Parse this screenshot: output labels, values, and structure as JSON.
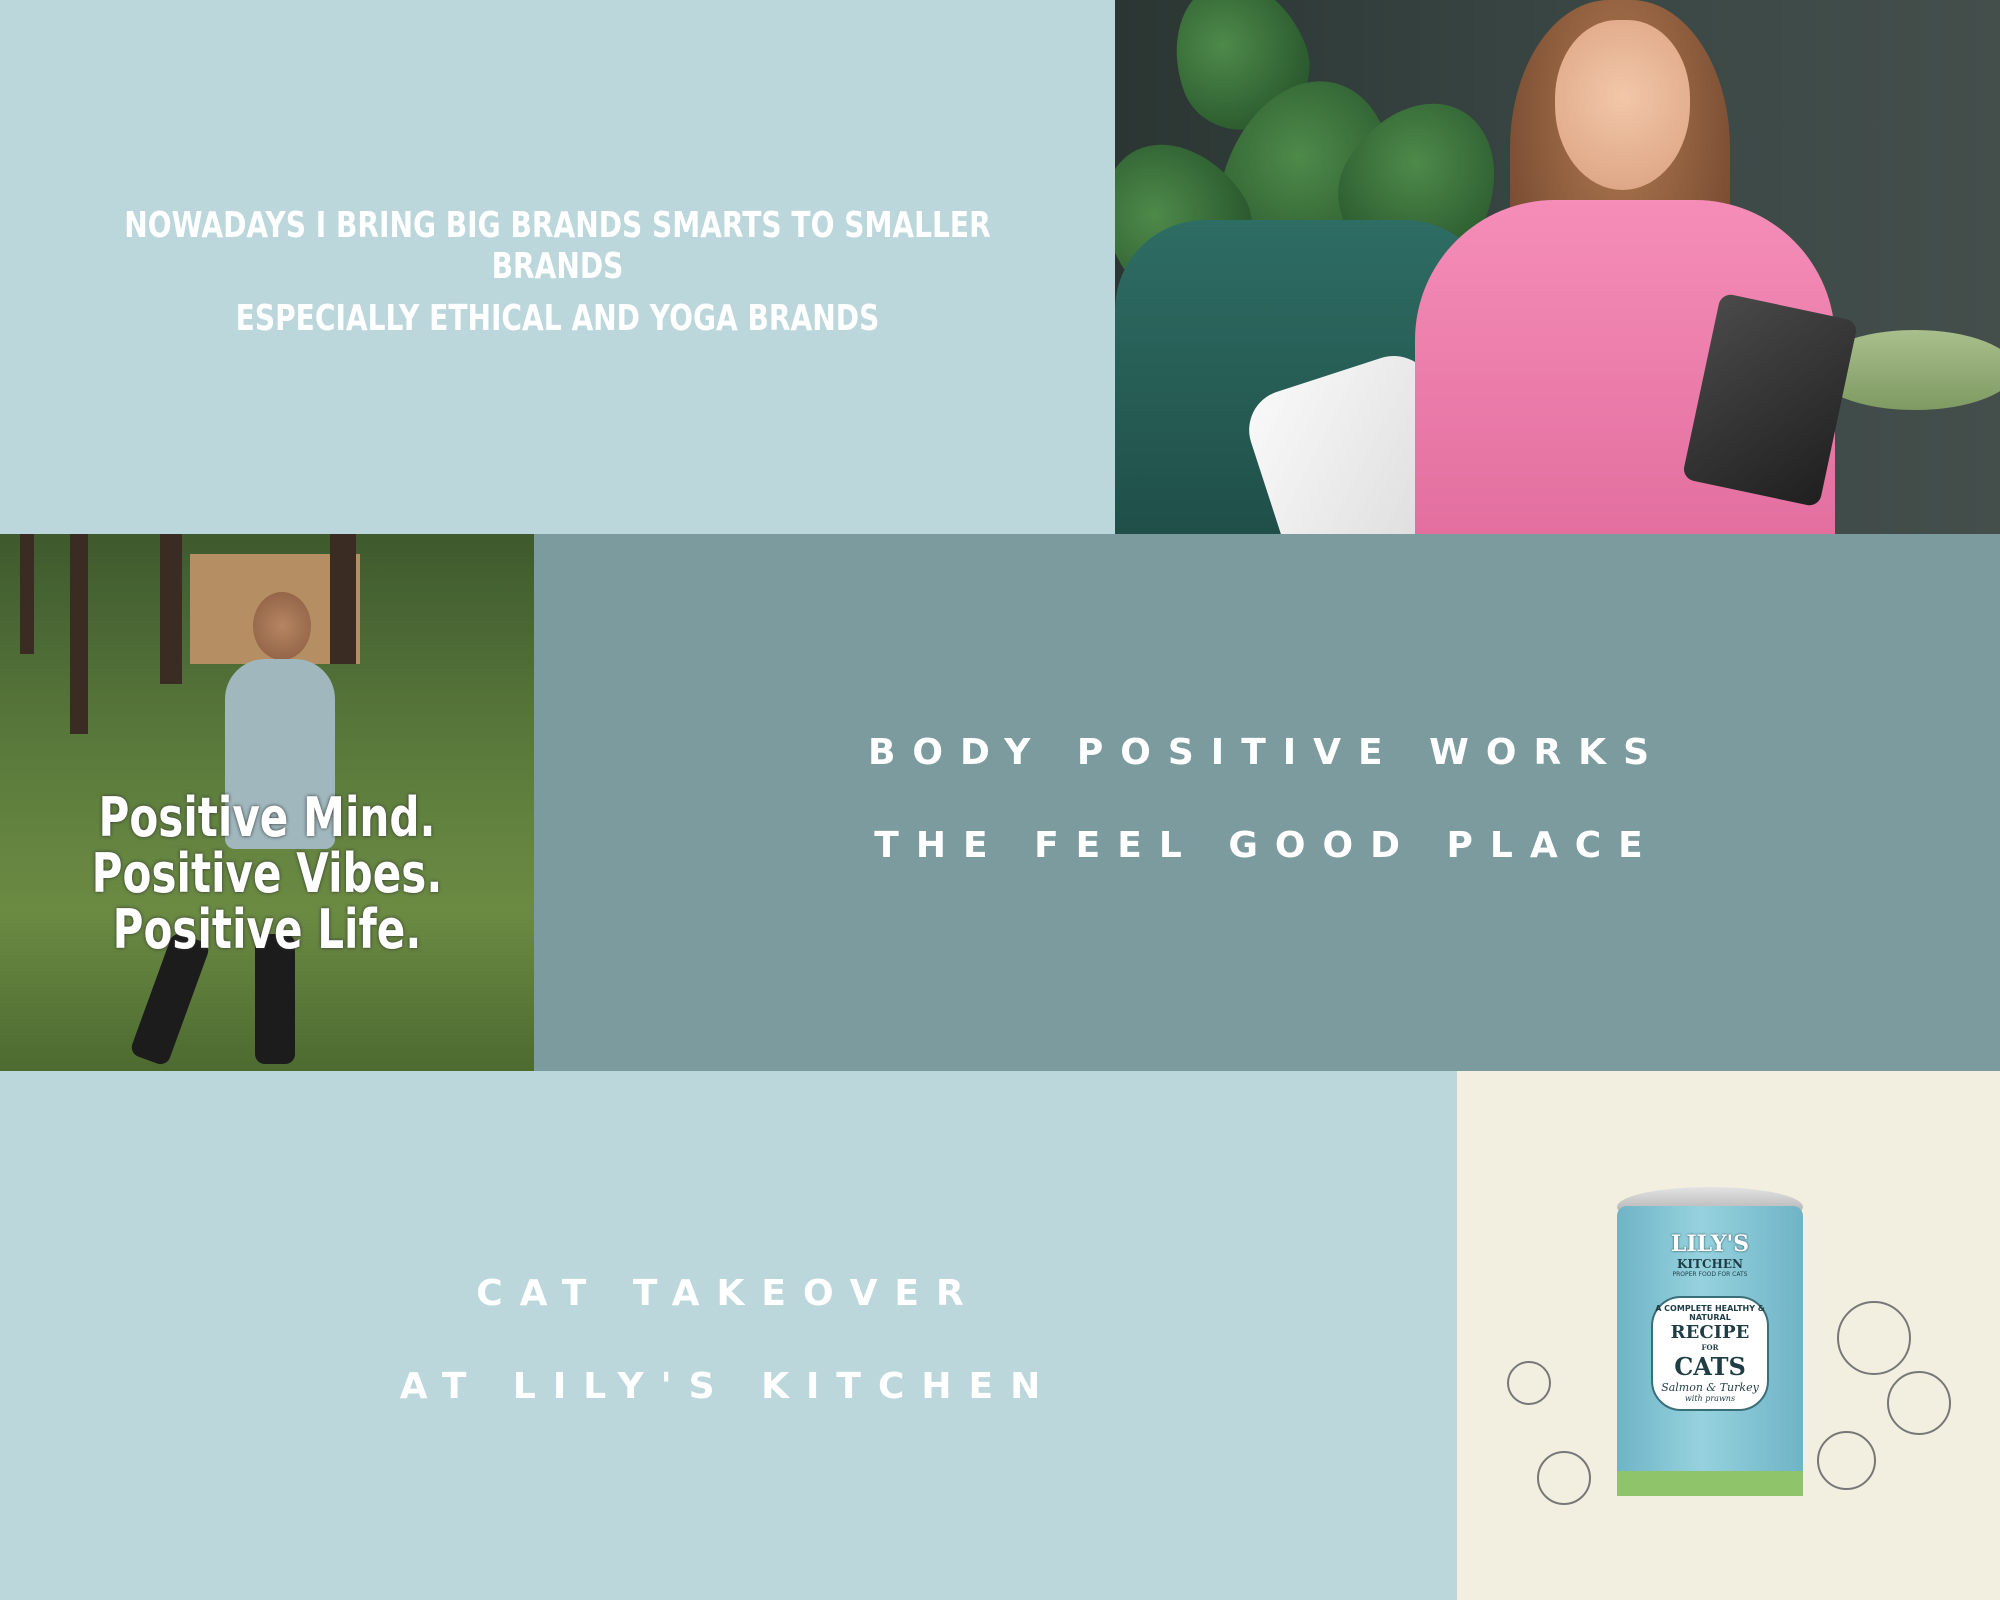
{
  "section1": {
    "line1": "NOWADAYS I BRING BIG BRANDS SMARTS TO SMALLER BRANDS",
    "line2": "ESPECIALLY ETHICAL AND YOGA BRANDS"
  },
  "section2": {
    "line1": "BODY POSITIVE WORKS",
    "line2": "THE FEEL GOOD PLACE",
    "image_text": [
      "Positive Mind.",
      "Positive Vibes.",
      "Positive Life."
    ]
  },
  "section3": {
    "line1": "CAT TAKEOVER",
    "line2": "AT LILY'S KITCHEN",
    "can": {
      "brand": "LILY'S",
      "brand2": "KITCHEN",
      "tagline": "PROPER FOOD FOR CATS",
      "desc": "A COMPLETE HEALTHY & NATURAL",
      "recipe": "RECIPE",
      "for": "FOR",
      "cats": "CATS",
      "flavor": "Salmon & Turkey",
      "flavor2": "with prawns"
    }
  },
  "colors": {
    "light_panel": "#bcd7db",
    "dark_panel": "#7c9b9f",
    "cream": "#f3efe0",
    "text": "#ffffff"
  }
}
